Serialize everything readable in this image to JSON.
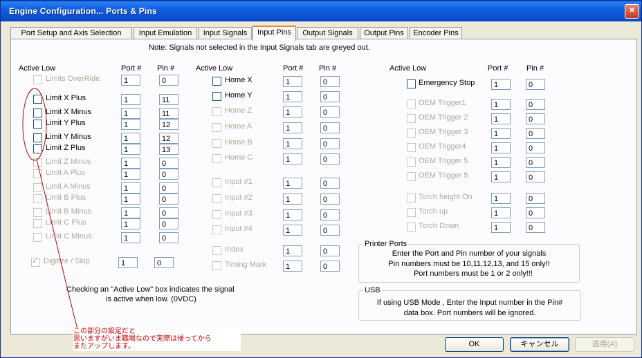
{
  "window": {
    "title": "Engine Configuration... Ports & Pins",
    "close_label": "×"
  },
  "tabs": [
    {
      "label": "Port Setup and Axis Selection",
      "active": false
    },
    {
      "label": "Input Emulation",
      "active": false
    },
    {
      "label": "Input Signals",
      "active": false
    },
    {
      "label": "Input Pins",
      "active": true
    },
    {
      "label": "Output Signals",
      "active": false
    },
    {
      "label": "Output Pins",
      "active": false
    },
    {
      "label": "Encoder Pins",
      "active": false
    }
  ],
  "note": "Note: Signals not selected in the Input Signals tab are greyed out.",
  "headers": {
    "active_low": "Active Low",
    "port": "Port #",
    "pin": "Pin #"
  },
  "col1": [
    {
      "name": "Limits OverRide",
      "enabled": false,
      "port": "1",
      "pin": "0"
    },
    {
      "name": "Limit X Plus",
      "enabled": true,
      "port": "1",
      "pin": "11"
    },
    {
      "name": "Limit X Minus",
      "enabled": true,
      "port": "1",
      "pin": "11"
    },
    {
      "name": "Limit Y Plus",
      "enabled": true,
      "port": "1",
      "pin": "12"
    },
    {
      "name": "Limit Y Minus",
      "enabled": true,
      "port": "1",
      "pin": "12"
    },
    {
      "name": "Limit Z Plus",
      "enabled": true,
      "port": "1",
      "pin": "13"
    },
    {
      "name": "Limit Z Minus",
      "enabled": false,
      "port": "1",
      "pin": "0"
    },
    {
      "name": "Limit A Plus",
      "enabled": false,
      "port": "1",
      "pin": "0"
    },
    {
      "name": "Limit A Minus",
      "enabled": false,
      "port": "1",
      "pin": "0"
    },
    {
      "name": "Limit B Plus",
      "enabled": false,
      "port": "1",
      "pin": "0"
    },
    {
      "name": "Limit B Minus",
      "enabled": false,
      "port": "1",
      "pin": "0"
    },
    {
      "name": "Limit C Plus",
      "enabled": false,
      "port": "1",
      "pin": "0"
    },
    {
      "name": "Limit C Minus",
      "enabled": false,
      "port": "1",
      "pin": "0"
    }
  ],
  "digitize": {
    "name": "Digitize / Skip",
    "checked": true,
    "enabled": false,
    "port": "1",
    "pin": "0"
  },
  "col2": [
    {
      "name": "Home X",
      "enabled": true,
      "port": "1",
      "pin": "0"
    },
    {
      "name": "Home Y",
      "enabled": true,
      "port": "1",
      "pin": "0"
    },
    {
      "name": "Home Z",
      "enabled": false,
      "port": "1",
      "pin": "0"
    },
    {
      "name": "Home A",
      "enabled": false,
      "port": "1",
      "pin": "0"
    },
    {
      "name": "Home B",
      "enabled": false,
      "port": "1",
      "pin": "0"
    },
    {
      "name": "Home C",
      "enabled": false,
      "port": "1",
      "pin": "0"
    },
    {
      "name": "Input #1",
      "enabled": false,
      "port": "1",
      "pin": "0"
    },
    {
      "name": "Input #2",
      "enabled": false,
      "port": "1",
      "pin": "0"
    },
    {
      "name": "Input #3",
      "enabled": false,
      "port": "1",
      "pin": "0"
    },
    {
      "name": "Input #4",
      "enabled": false,
      "port": "1",
      "pin": "0"
    },
    {
      "name": "Index",
      "enabled": false,
      "port": "1",
      "pin": "0"
    },
    {
      "name": "Timing Mark",
      "enabled": false,
      "port": "1",
      "pin": "0"
    }
  ],
  "col3": [
    {
      "name": "Emergency Stop",
      "enabled": true,
      "port": "1",
      "pin": "0"
    },
    {
      "name": "OEM Trigger1",
      "enabled": false,
      "port": "1",
      "pin": "0"
    },
    {
      "name": "OEM Trigger 2",
      "enabled": false,
      "port": "1",
      "pin": "0"
    },
    {
      "name": "OEM Trigger 3",
      "enabled": false,
      "port": "1",
      "pin": "0"
    },
    {
      "name": "OEM Trigger4",
      "enabled": false,
      "port": "1",
      "pin": "0"
    },
    {
      "name": "OEM Trigger 5",
      "enabled": false,
      "port": "1",
      "pin": "0"
    },
    {
      "name": "OEM Trigger 5",
      "enabled": false,
      "port": "1",
      "pin": "0"
    },
    {
      "name": "Torch height On",
      "enabled": false,
      "port": "1",
      "pin": "0"
    },
    {
      "name": "Torch up",
      "enabled": false,
      "port": "1",
      "pin": "0"
    },
    {
      "name": "Torch Down",
      "enabled": false,
      "port": "1",
      "pin": "0"
    }
  ],
  "active_low_note": [
    "Checking an \"Active Low\" box indicates the signal",
    "is active when low. (0VDC)"
  ],
  "printer_ports": {
    "title": "Printer Ports",
    "lines": [
      "Enter the Port and Pin number of your signals",
      "Pin numbers must be 10,11,12,13, and 15 only!!",
      "Port numbers must be 1 or 2 only!!!"
    ]
  },
  "usb": {
    "title": "USB",
    "lines": [
      "If using USB Mode , Enter the Input number in the Pin#",
      "data box. Port numbers will be ignored."
    ]
  },
  "buttons": {
    "ok": "OK",
    "cancel": "キャンセル",
    "apply": "適用(A)"
  },
  "annotation": [
    "この部分の設定だと",
    "思いますがいま職場なので実際は帰ってから",
    "またアップします。"
  ],
  "colors": {
    "annotation": "#c00000",
    "disabled_text": "#aca899",
    "title_bar": "#0a5fe0",
    "tab_highlight": "#e68b2c"
  }
}
